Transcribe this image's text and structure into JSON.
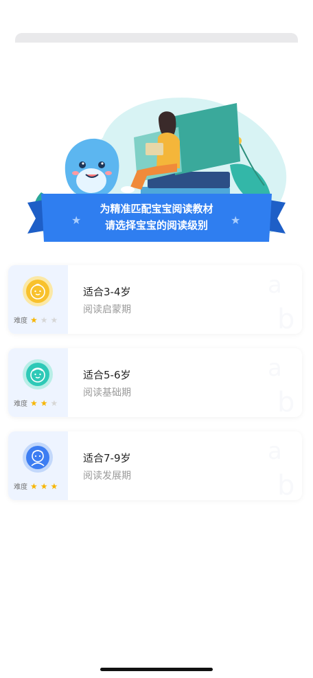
{
  "banner": {
    "line1": "为精准匹配宝宝阅读教材",
    "line2": "请选择宝宝的阅读级别"
  },
  "difficulty_label": "难度",
  "levels": [
    {
      "title": "适合3-4岁",
      "subtitle": "阅读启蒙期",
      "stars": 1,
      "badge_color": "#f8c12c",
      "badge_icon": "baby-face-icon"
    },
    {
      "title": "适合5-6岁",
      "subtitle": "阅读基础期",
      "stars": 2,
      "badge_color": "#2ec9b7",
      "badge_icon": "child-face-icon"
    },
    {
      "title": "适合7-9岁",
      "subtitle": "阅读发展期",
      "stars": 3,
      "badge_color": "#3d7df2",
      "badge_icon": "kid-face-icon"
    }
  ],
  "colors": {
    "ribbon": "#2f7ef0",
    "star_on": "#f7b500",
    "star_off": "#d6d6d6"
  }
}
